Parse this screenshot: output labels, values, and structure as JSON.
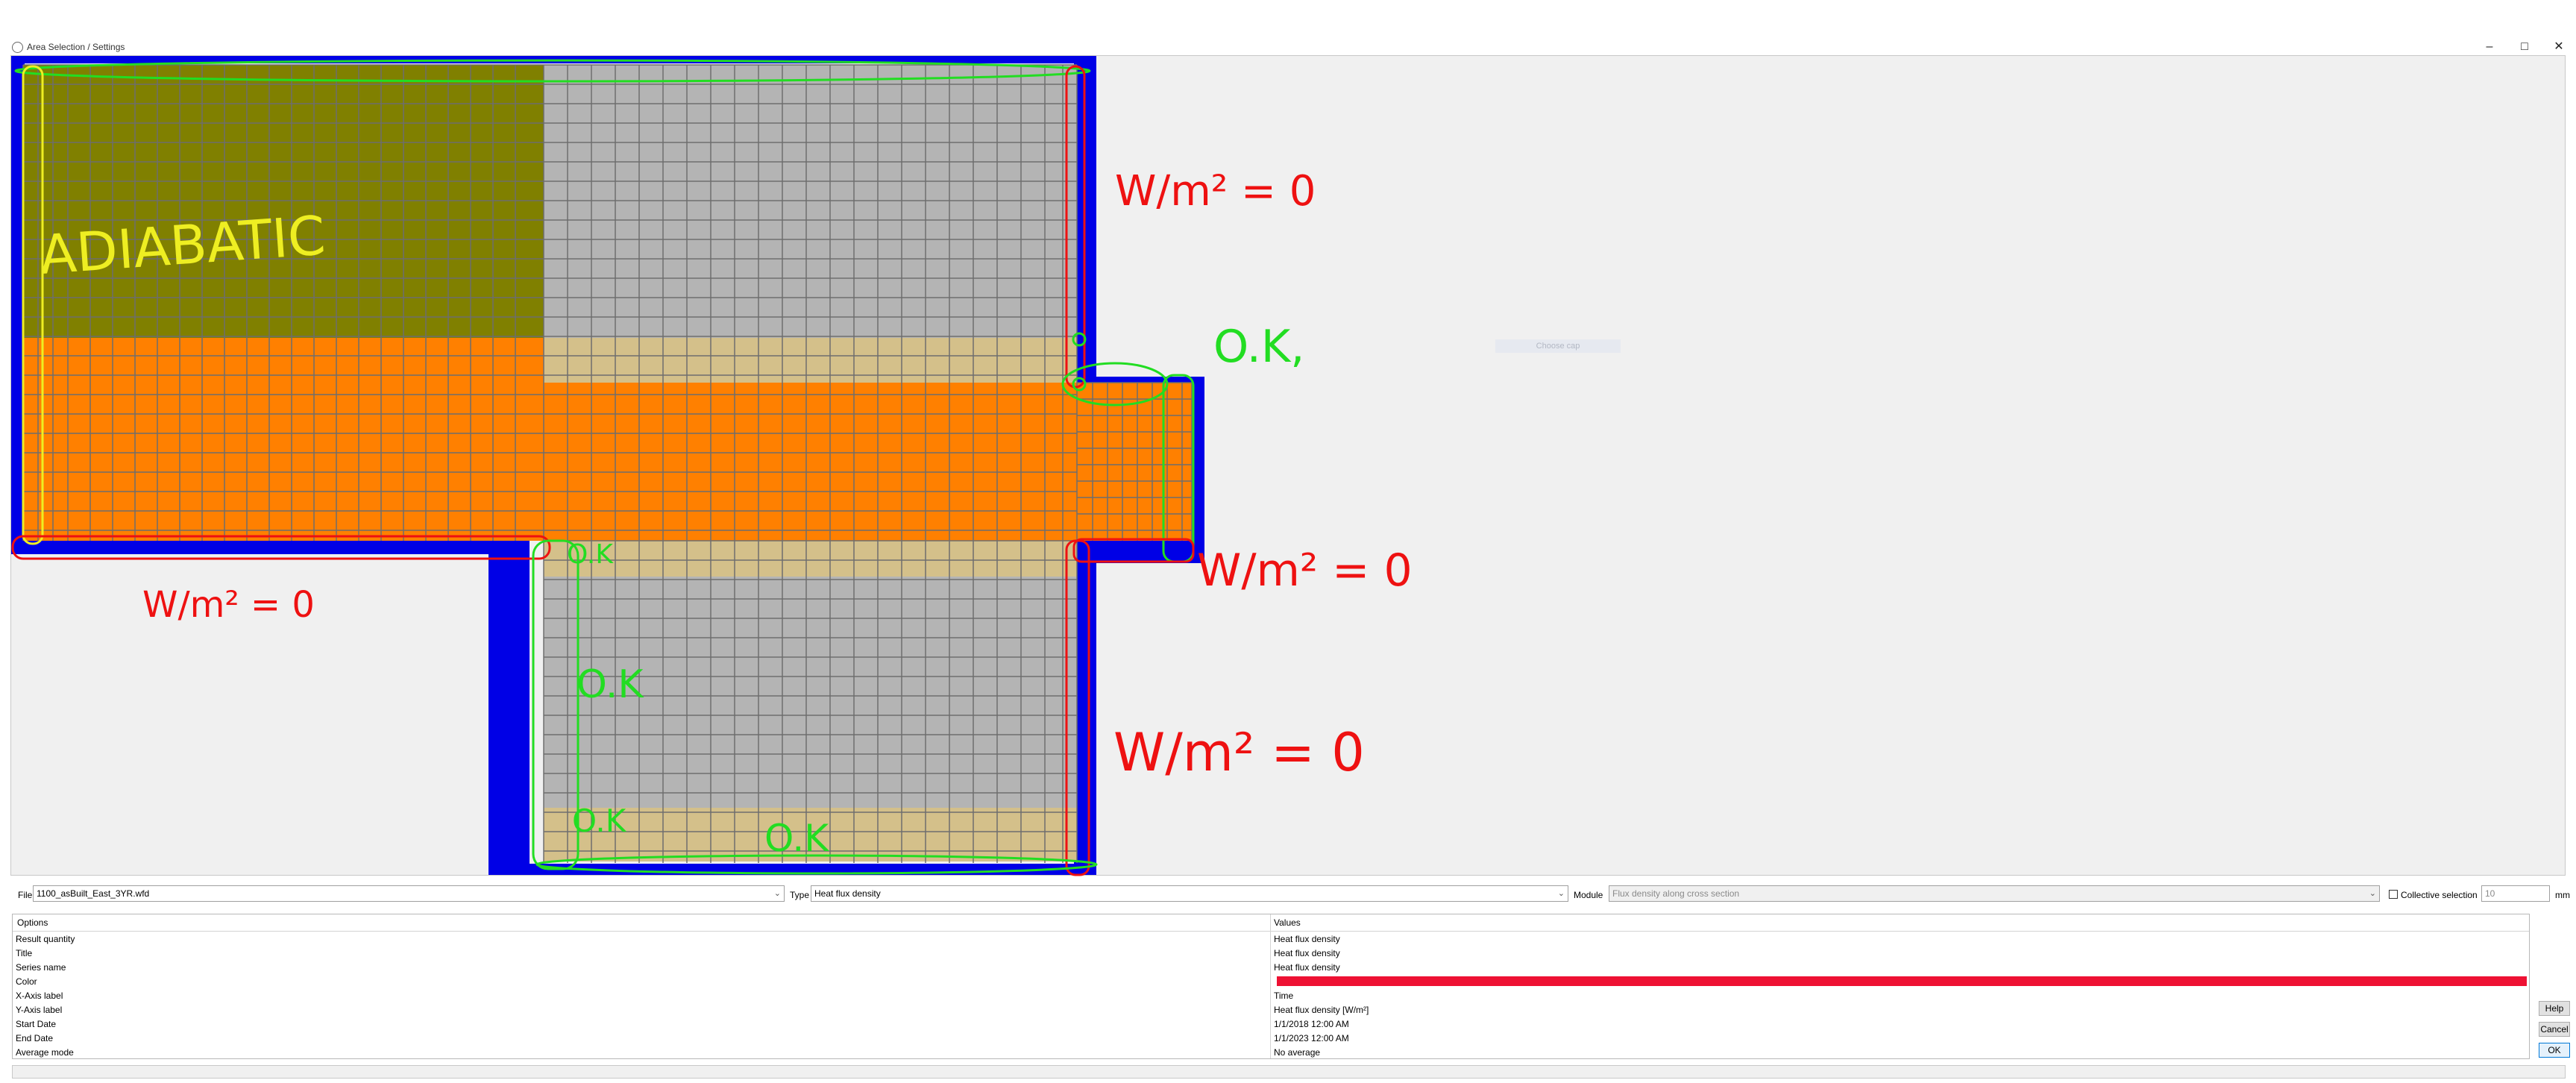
{
  "window": {
    "title": "Area Selection / Settings",
    "minimize_glyph": "–",
    "maximize_glyph": "□",
    "close_glyph": "✕"
  },
  "canvas": {
    "ghost_text": "Choose cap",
    "colors": {
      "boundary": "#0000e6",
      "olive": "#808000",
      "orange": "#ff8000",
      "gray": "#b4b4b4",
      "tan": "#d4c08a",
      "grid": "#6e6e6e",
      "ink_red": "#ee1111",
      "ink_green": "#22dd22",
      "ink_yellow": "#eeee22"
    },
    "annotations": {
      "adiabatic": "ADIABATIC",
      "ok": "O.K",
      "ok_comma": "O.K,",
      "flux_zero": "W/m² = 0"
    }
  },
  "controls": {
    "file_label": "File",
    "file_value": "1100_asBuilt_East_3YR.wfd",
    "type_label": "Type",
    "type_value": "Heat flux density",
    "module_label": "Module",
    "module_value": "Flux density along cross section",
    "collective_label": "Collective selection",
    "collective_checked": false,
    "grid_value": "10",
    "unit": "mm"
  },
  "options": {
    "header_options": "Options",
    "header_values": "Values",
    "rows": [
      {
        "key": "Result quantity",
        "value": "Heat flux density"
      },
      {
        "key": "Title",
        "value": "Heat flux density"
      },
      {
        "key": "Series name",
        "value": "Heat flux density"
      },
      {
        "key": "Color",
        "value": "",
        "swatch": "#ee1133"
      },
      {
        "key": "X-Axis label",
        "value": "Time"
      },
      {
        "key": "Y-Axis label",
        "value": "Heat flux density [W/m²]"
      },
      {
        "key": "Start Date",
        "value": "1/1/2018 12:00 AM"
      },
      {
        "key": "End Date",
        "value": "1/1/2023 12:00 AM"
      },
      {
        "key": "Average mode",
        "value": "No average"
      }
    ]
  },
  "buttons": {
    "help": "Help",
    "cancel": "Cancel",
    "ok": "OK"
  }
}
